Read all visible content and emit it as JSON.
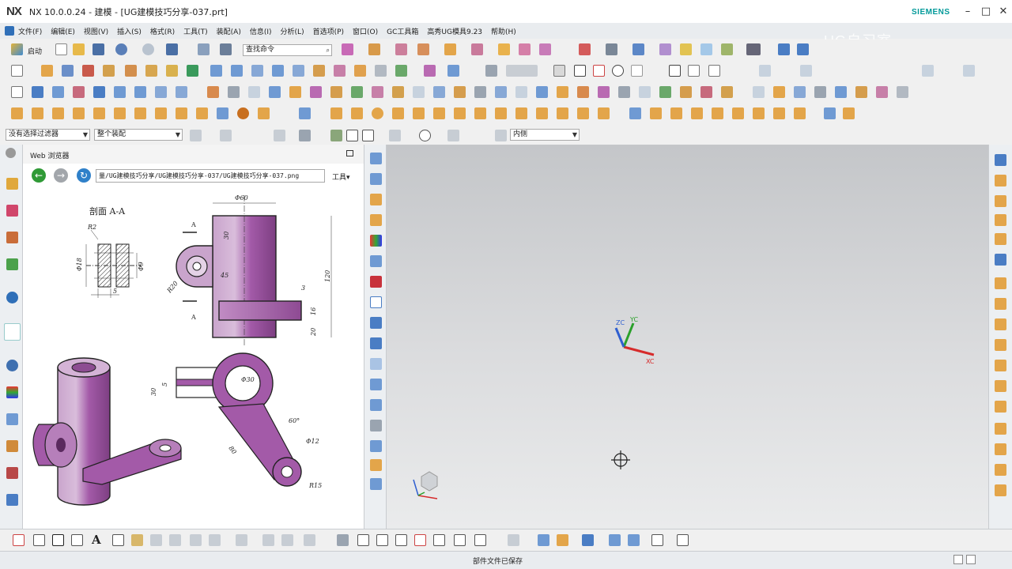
{
  "window": {
    "logo": "NX",
    "title": "NX 10.0.0.24 - 建模 - [UG建模技巧分享-037.prt]",
    "brand": "SIEMENS",
    "watermark": "UG自习室"
  },
  "menu": [
    "文件(F)",
    "编辑(E)",
    "视图(V)",
    "插入(S)",
    "格式(R)",
    "工具(T)",
    "装配(A)",
    "信息(I)",
    "分析(L)",
    "首选项(P)",
    "窗口(O)",
    "GC工具箱",
    "高秀UG模具9.23",
    "帮助(H)"
  ],
  "toolbar": {
    "start_label": "启动",
    "command_search_placeholder": "查找命令",
    "selection_filter": "没有选择过滤器",
    "assembly_scope": "整个装配",
    "snap_option": "内侧"
  },
  "web_panel": {
    "title": "Web 浏览器",
    "url": "量/UG建模技巧分享/UG建模技巧分享-037/UG建模技巧分享-037.png",
    "tools_label": "工具"
  },
  "drawing": {
    "section_label": "剖面 A-A",
    "section_letter": "A",
    "dims": {
      "d60": "Φ60",
      "d18": "Φ18",
      "d9": "Φ9",
      "r2": "R2",
      "w5": "5",
      "h30": "30",
      "r20": "R20",
      "d45": "45",
      "t3": "3",
      "h16": "16",
      "h20": "20",
      "h120": "120",
      "v30": "30",
      "v5": "5",
      "d30": "Φ30",
      "a60": "60°",
      "d12": "Φ12",
      "l80": "80",
      "r15": "R15"
    }
  },
  "csys": {
    "xc": "XC",
    "yc": "YC",
    "zc": "ZC"
  },
  "status_text": "部件文件已保存",
  "colors": {
    "part_purple": "#a35aa8",
    "axis_x": "#d62b2b",
    "axis_y": "#2aa02a",
    "axis_z": "#2f5fd0"
  }
}
